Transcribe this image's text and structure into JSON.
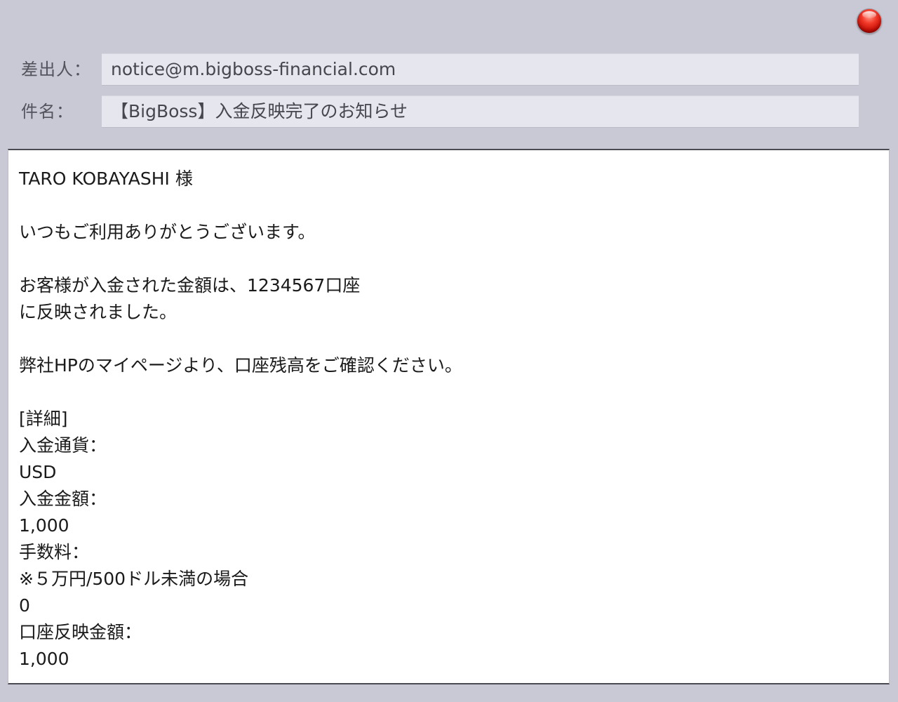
{
  "window": {
    "close_button_color": "#e0261a"
  },
  "header": {
    "from_label": "差出人：",
    "from_value": "notice@m.bigboss-financial.com",
    "subject_label": "件名：",
    "subject_value": "【BigBoss】入金反映完了のお知らせ"
  },
  "body": {
    "lines": [
      "TARO KOBAYASHI 様",
      "",
      "いつもご利用ありがとうございます。",
      "",
      "お客様が入金された金額は、1234567口座",
      "に反映されました。",
      "",
      "弊社HPのマイページより、口座残高をご確認ください。",
      "",
      "[詳細]",
      "入金通貨：",
      "USD",
      "入金金額：",
      "1,000",
      "手数料：",
      "※５万円/500ドル未満の場合",
      "0",
      "口座反映金額：",
      "1,000"
    ]
  }
}
